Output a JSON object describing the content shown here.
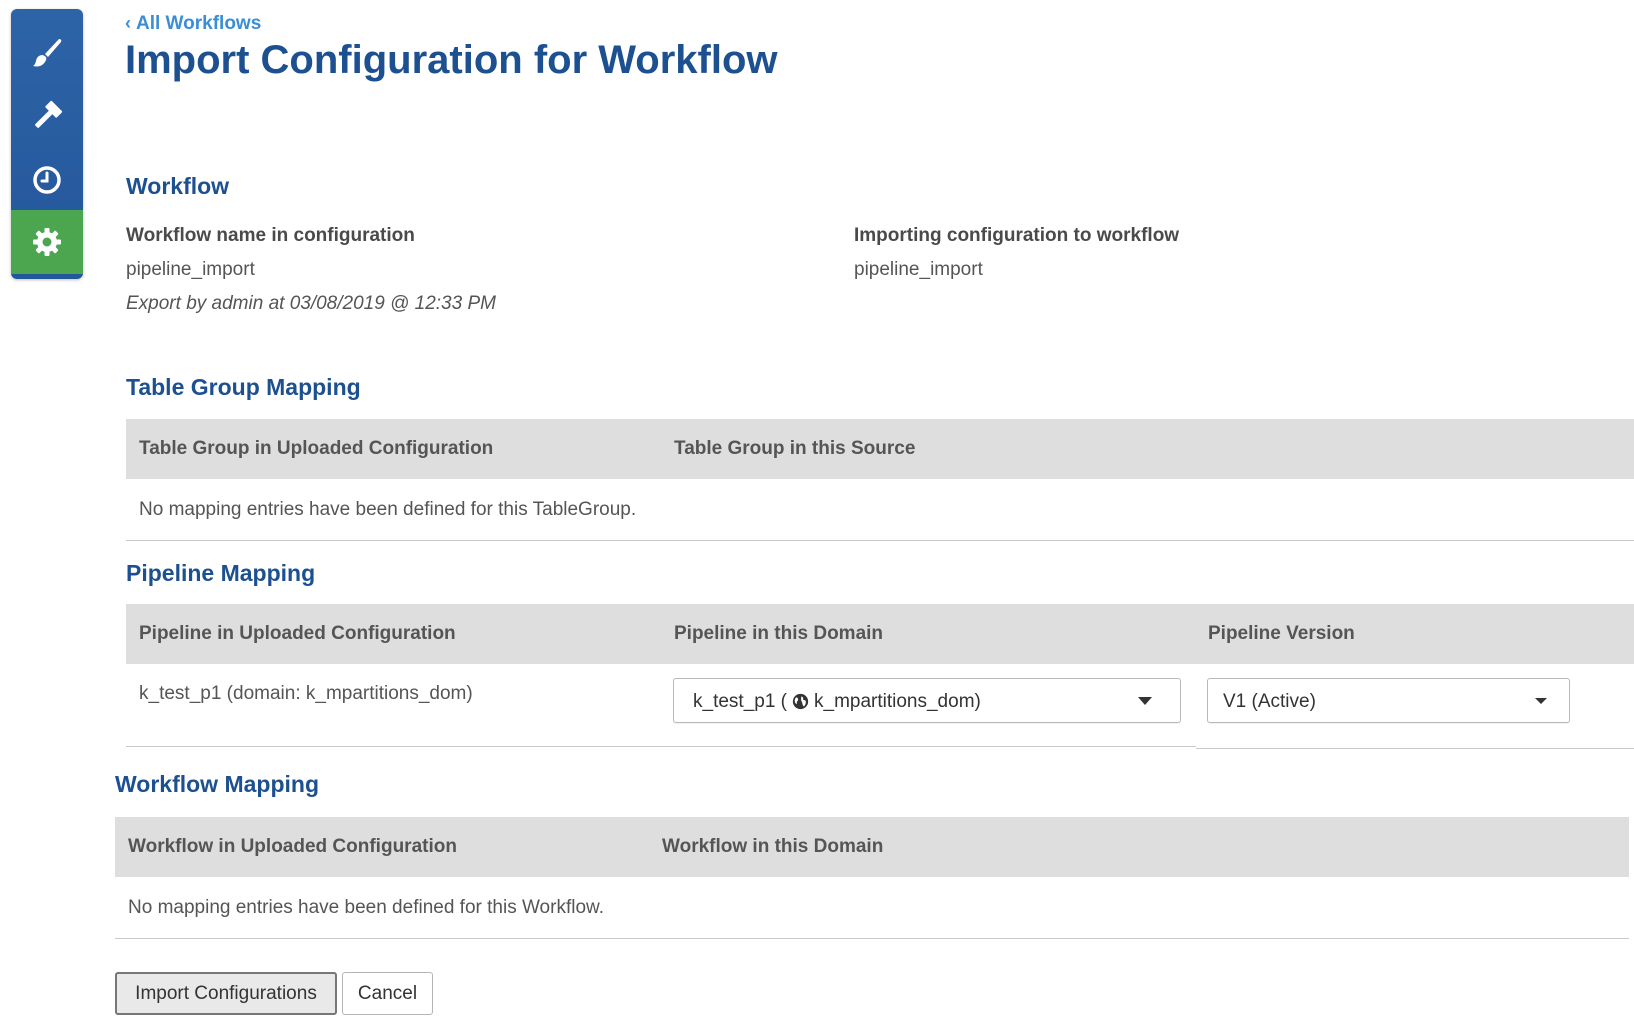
{
  "nav": {
    "items": [
      {
        "icon": "paintbrush-icon"
      },
      {
        "icon": "hammer-icon"
      },
      {
        "icon": "clock-icon"
      },
      {
        "icon": "gear-icon",
        "active": true
      }
    ],
    "active_color": "#4ba64f",
    "bg_color": "#2d64a7"
  },
  "header": {
    "back_link": "All Workflows",
    "title": "Import Configuration for Workflow"
  },
  "workflow": {
    "heading": "Workflow",
    "config_label": "Workflow name in configuration",
    "config_value": "pipeline_import",
    "export_note": "Export by admin at 03/08/2019 @ 12:33 PM",
    "target_label": "Importing configuration to workflow",
    "target_value": "pipeline_import"
  },
  "table_group_mapping": {
    "heading": "Table Group Mapping",
    "columns": [
      "Table Group in Uploaded Configuration",
      "Table Group in this Source"
    ],
    "empty_message": "No mapping entries have been defined for this TableGroup."
  },
  "pipeline_mapping": {
    "heading": "Pipeline Mapping",
    "columns": [
      "Pipeline in Uploaded Configuration",
      "Pipeline in this Domain",
      "Pipeline Version"
    ],
    "rows": [
      {
        "source": "k_test_p1 (domain: k_mpartitions_dom)",
        "domain_select_prefix": "k_test_p1 (",
        "domain_select_name": "k_mpartitions_dom)",
        "version_select": "V1 (Active)"
      }
    ]
  },
  "workflow_mapping": {
    "heading": "Workflow Mapping",
    "columns": [
      "Workflow in Uploaded Configuration",
      "Workflow in this Domain"
    ],
    "empty_message": "No mapping entries have been defined for this Workflow."
  },
  "actions": {
    "import_label": "Import Configurations",
    "cancel_label": "Cancel"
  }
}
